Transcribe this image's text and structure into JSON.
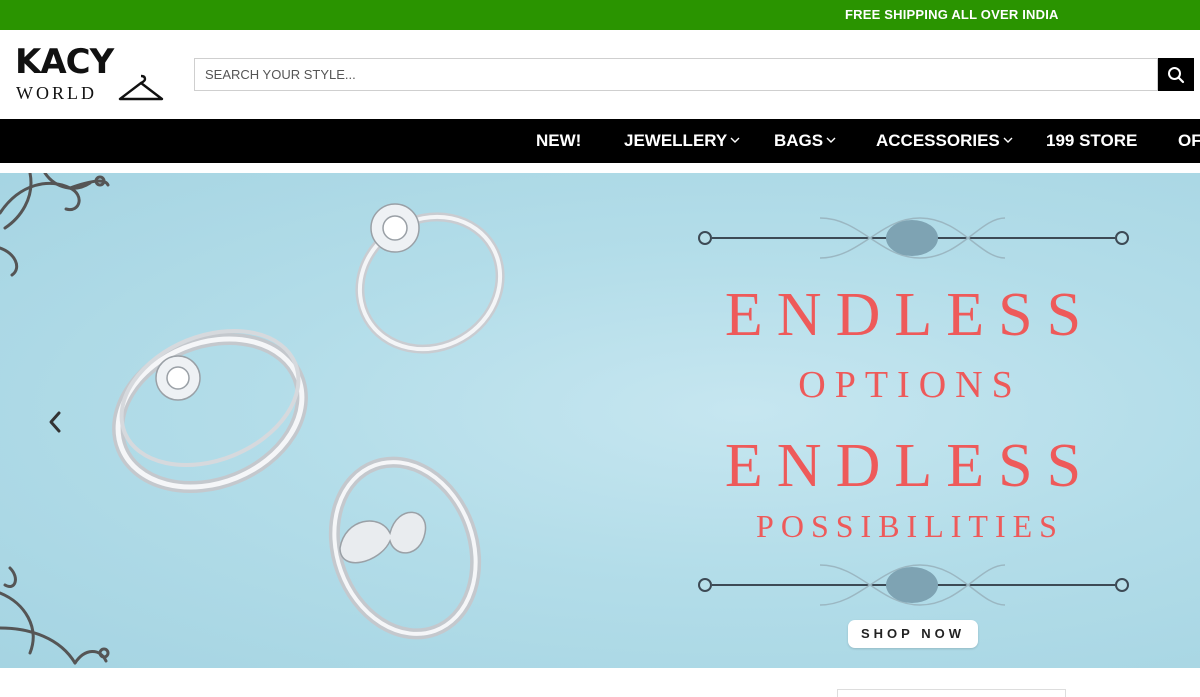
{
  "topbar": {
    "promo_text": "FREE SHIPPING ALL OVER INDIA",
    "bg_color": "#2a9400"
  },
  "header": {
    "logo": {
      "line1": "KACY",
      "line2": "WORLD",
      "icon": "hanger-icon"
    },
    "search": {
      "placeholder": "SEARCH YOUR STYLE...",
      "value": "",
      "button_icon": "search-icon"
    }
  },
  "nav": {
    "items": [
      {
        "label": "NEW!",
        "has_dropdown": false
      },
      {
        "label": "JEWELLERY",
        "has_dropdown": true
      },
      {
        "label": "BAGS",
        "has_dropdown": true
      },
      {
        "label": "ACCESSORIES",
        "has_dropdown": true
      },
      {
        "label": "199 STORE",
        "has_dropdown": false
      },
      {
        "label": "OF",
        "has_dropdown": false
      }
    ]
  },
  "banner": {
    "line1": "ENDLESS",
    "line2": "OPTIONS",
    "line3": "ENDLESS",
    "line4": "POSSIBILITIES",
    "cta": "SHOP NOW",
    "text_color": "#ee5a5a",
    "prev_icon": "chevron-left-icon"
  }
}
